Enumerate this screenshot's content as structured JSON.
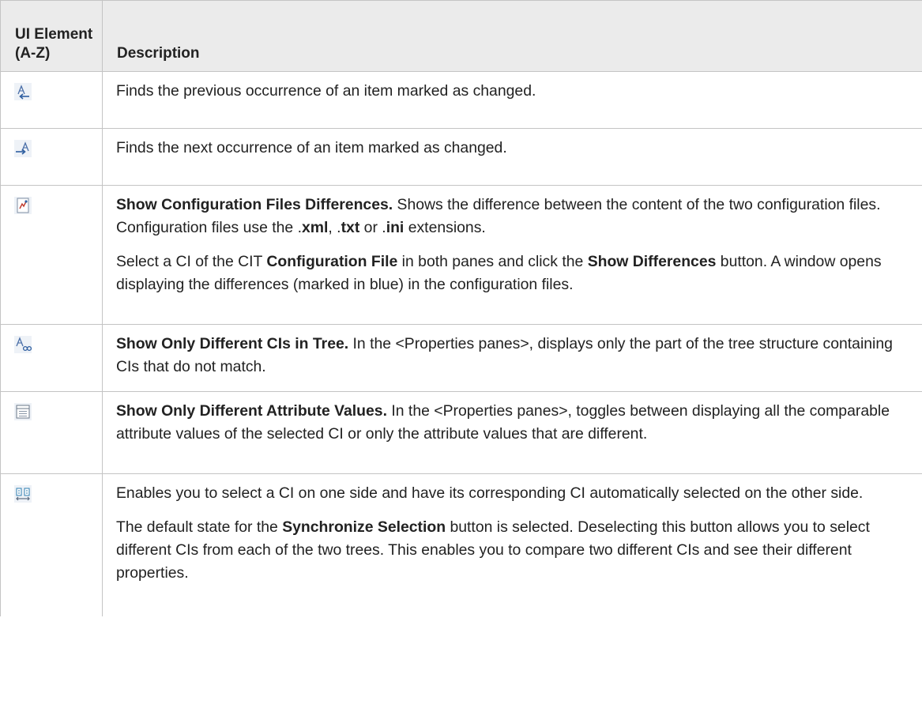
{
  "table": {
    "headers": {
      "ui_element": "UI Element (A-Z)",
      "description": "Description"
    },
    "rows": [
      {
        "icon": "previous-change-icon",
        "p1": {
          "t0": "Finds the previous occurrence of an item marked as changed."
        }
      },
      {
        "icon": "next-change-icon",
        "p1": {
          "t0": "Finds the next occurrence of an item marked as changed."
        }
      },
      {
        "icon": "show-config-differences-icon",
        "p1": {
          "b0": "Show Configuration Files Differences.",
          "t0": " Shows the difference between the content of the two configuration files. Configuration files use the .",
          "b1": "xml",
          "t1": ", .",
          "b2": "txt",
          "t2": " or .",
          "b3": "ini",
          "t3": " extensions."
        },
        "p2": {
          "t0": "Select a CI of the CIT ",
          "b0": "Configuration File",
          "t1": " in both panes and click the ",
          "b1": "Show Differences",
          "t2": " button. A window opens displaying the differences (marked in blue) in the configuration files."
        }
      },
      {
        "icon": "show-different-cis-icon",
        "p1": {
          "b0": "Show Only Different CIs in Tree.",
          "t0": " In the <Properties panes>, displays only the part of the tree structure containing CIs that do not match."
        }
      },
      {
        "icon": "show-different-attributes-icon",
        "p1": {
          "b0": "Show Only Different Attribute Values.",
          "t0": " In the <Properties panes>, toggles between displaying all the comparable attribute values of the selected CI or only the attribute values that are different."
        }
      },
      {
        "icon": "synchronize-selection-icon",
        "p1": {
          "t0": "Enables you to select a CI on one side and have its corresponding CI automatically selected on the other side."
        },
        "p2": {
          "t0": "The default state for the ",
          "b0": "Synchronize Selection",
          "t1": " button is selected. Deselecting this button allows you to select different CIs from each of the two trees. This enables you to compare two different CIs and see their different properties."
        }
      }
    ]
  }
}
